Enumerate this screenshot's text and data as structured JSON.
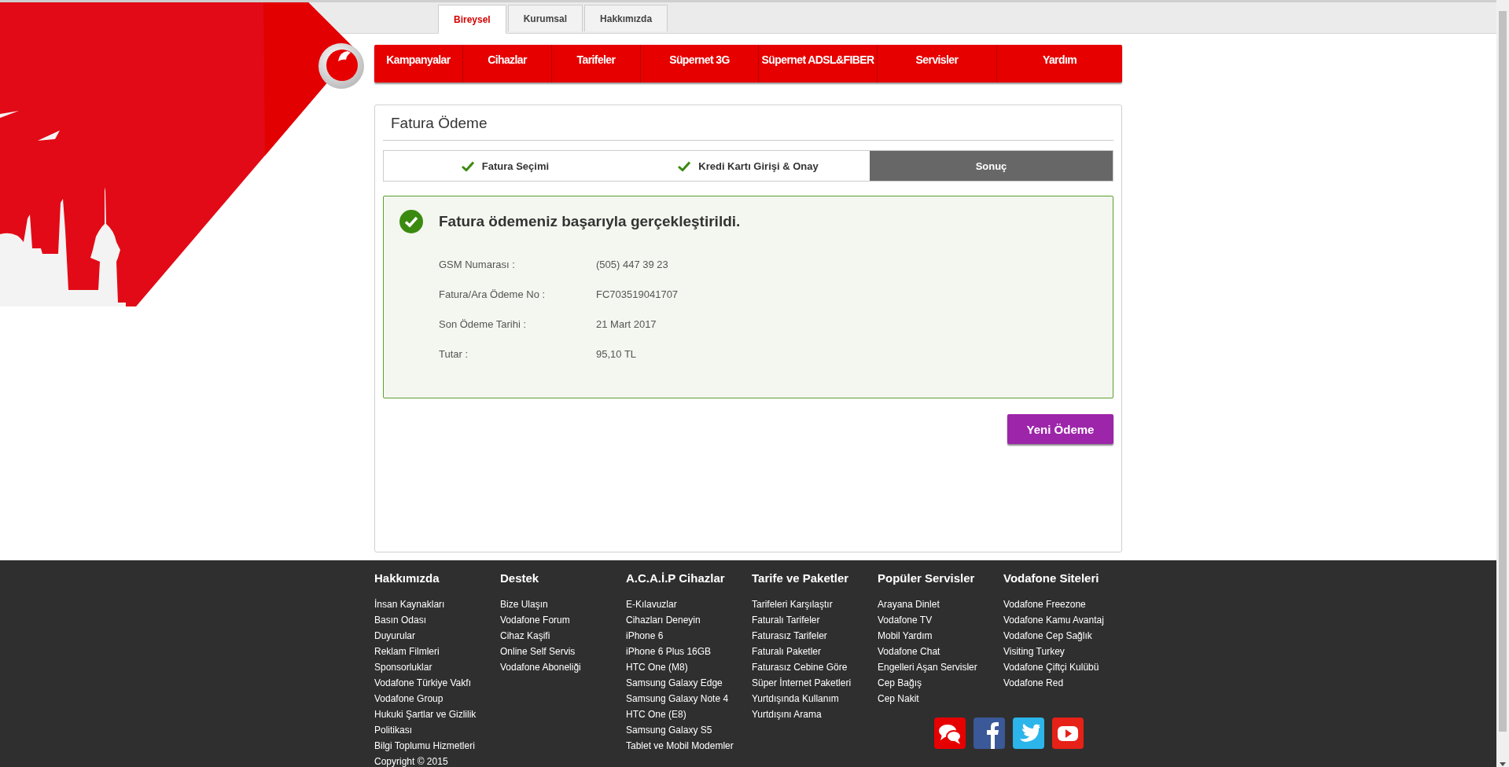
{
  "top_tabs": [
    {
      "label": "Bireysel",
      "selected": true
    },
    {
      "label": "Kurumsal",
      "selected": false
    },
    {
      "label": "Hakkımızda",
      "selected": false
    }
  ],
  "nav": [
    "Kampanyalar",
    "Cihazlar",
    "Tarifeler",
    "Süpernet 3G",
    "Süpernet ADSL&FIBER",
    "Servisler",
    "Yardım"
  ],
  "card": {
    "title": "Fatura Ödeme",
    "steps": [
      {
        "label": "Fatura Seçimi",
        "done": true,
        "selected": false
      },
      {
        "label": "Kredi Kartı Girişi & Onay",
        "done": true,
        "selected": false
      },
      {
        "label": "Sonuç",
        "done": false,
        "selected": true
      }
    ],
    "result": {
      "message": "Fatura ödemeniz başarıyla gerçekleştirildi.",
      "details": [
        {
          "label": "GSM Numarası :",
          "value": "(505) 447 39 23"
        },
        {
          "label": "Fatura/Ara Ödeme No :",
          "value": "FC703519041707"
        },
        {
          "label": "Son Ödeme Tarihi :",
          "value": "21 Mart 2017"
        },
        {
          "label": "Tutar :",
          "value": "95,10 TL"
        }
      ]
    },
    "button": "Yeni Ödeme"
  },
  "footer": {
    "columns": [
      {
        "heading": "Hakkımızda",
        "links": [
          "İnsan Kaynakları",
          "Basın Odası",
          "Duyurular",
          "Reklam Filmleri",
          "Sponsorluklar",
          "Vodafone Türkiye Vakfı",
          "Vodafone Group",
          "Hukuki Şartlar ve Gizlilik Politikası",
          "Bilgi Toplumu Hizmetleri"
        ]
      },
      {
        "heading": "Destek",
        "links": [
          "Bize Ulaşın",
          "Vodafone Forum",
          "Cihaz Kaşifi",
          "Online Self Servis",
          "Vodafone Aboneliği"
        ]
      },
      {
        "heading": "A.C.A.İ.P Cihazlar",
        "links": [
          "E-Kılavuzlar",
          "Cihazları Deneyin",
          "iPhone 6",
          "iPhone 6 Plus 16GB",
          "HTC One (M8)",
          "Samsung Galaxy Edge",
          "Samsung Galaxy Note 4",
          "HTC One (E8)",
          "Samsung Galaxy S5",
          "Tablet ve Mobil Modemler"
        ]
      },
      {
        "heading": "Tarife ve Paketler",
        "links": [
          "Tarifeleri Karşılaştır",
          "Faturalı Tarifeler",
          "Faturasız Tarifeler",
          "Faturalı Paketler",
          "Faturasız Cebine Göre",
          "Süper İnternet Paketleri",
          "Yurtdışında Kullanım",
          "Yurtdışını Arama"
        ]
      },
      {
        "heading": "Popüler Servisler",
        "links": [
          "Arayana Dinlet",
          "Vodafone TV",
          "Mobil Yardım",
          "Vodafone Chat",
          "Engelleri Aşan Servisler",
          "Cep Bağış",
          "Cep Nakit"
        ]
      },
      {
        "heading": "Vodafone Siteleri",
        "links": [
          "Vodafone Freezone",
          "Vodafone Kamu Avantaj",
          "Vodafone Cep Sağlık",
          "Visiting Turkey",
          "Vodafone Çiftçi Kulübü",
          "Vodafone Red"
        ]
      }
    ],
    "copyright": "Copyright © 2015"
  }
}
